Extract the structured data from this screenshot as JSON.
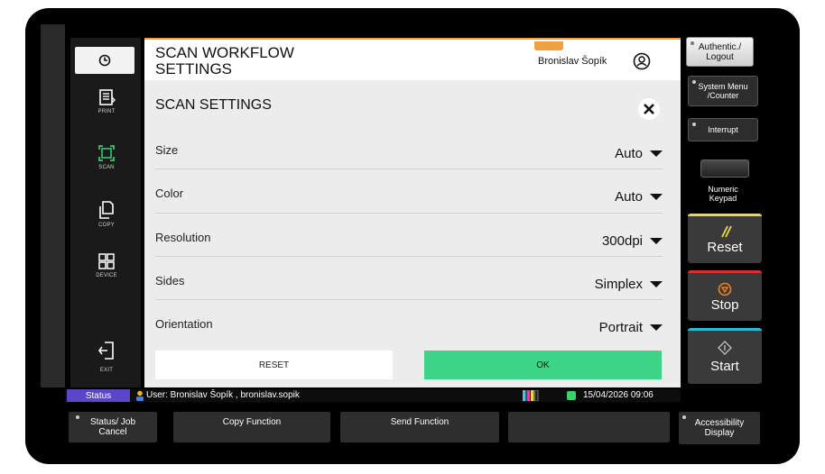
{
  "header": {
    "title": "SCAN WORKFLOW SETTINGS",
    "user_name": "Bronislav Šopík"
  },
  "nav": {
    "items": [
      {
        "label": "PRINT",
        "icon": "print-icon"
      },
      {
        "label": "SCAN",
        "icon": "scan-icon"
      },
      {
        "label": "COPY",
        "icon": "copy-icon"
      },
      {
        "label": "DEVICE",
        "icon": "device-icon"
      },
      {
        "label": "EXIT",
        "icon": "exit-icon"
      }
    ]
  },
  "scan_settings": {
    "title": "SCAN SETTINGS",
    "rows": [
      {
        "label": "Size",
        "value": "Auto"
      },
      {
        "label": "Color",
        "value": "Auto"
      },
      {
        "label": "Resolution",
        "value": "300dpi"
      },
      {
        "label": "Sides",
        "value": "Simplex"
      },
      {
        "label": "Orientation",
        "value": "Portrait"
      }
    ],
    "reset_label": "RESET",
    "ok_label": "OK"
  },
  "status_bar": {
    "status_label": "Status",
    "user_text": "User: Bronislav Šopík , bronislav.sopik",
    "datetime": "15/04/2026  09:06"
  },
  "hardware": {
    "authentic_logout": "Authentic./ Logout",
    "system_menu": "System Menu /Counter",
    "interrupt": "Interrupt",
    "numeric_keypad": "Numeric Keypad",
    "reset": "Reset",
    "stop": "Stop",
    "start": "Start",
    "accessibility": "Accessibility Display"
  },
  "bottom": {
    "status_job_cancel": "Status/ Job Cancel",
    "copy_function": "Copy Function",
    "send_function": "Send Function"
  },
  "colors": {
    "ok_green": "#3ed488",
    "scan_active": "#34c870",
    "status_purple": "#5b46c8",
    "reset_yellow": "#e8d84a",
    "stop_red": "#d83030",
    "start_cyan": "#30b8d8",
    "header_orange": "#f0a040"
  }
}
